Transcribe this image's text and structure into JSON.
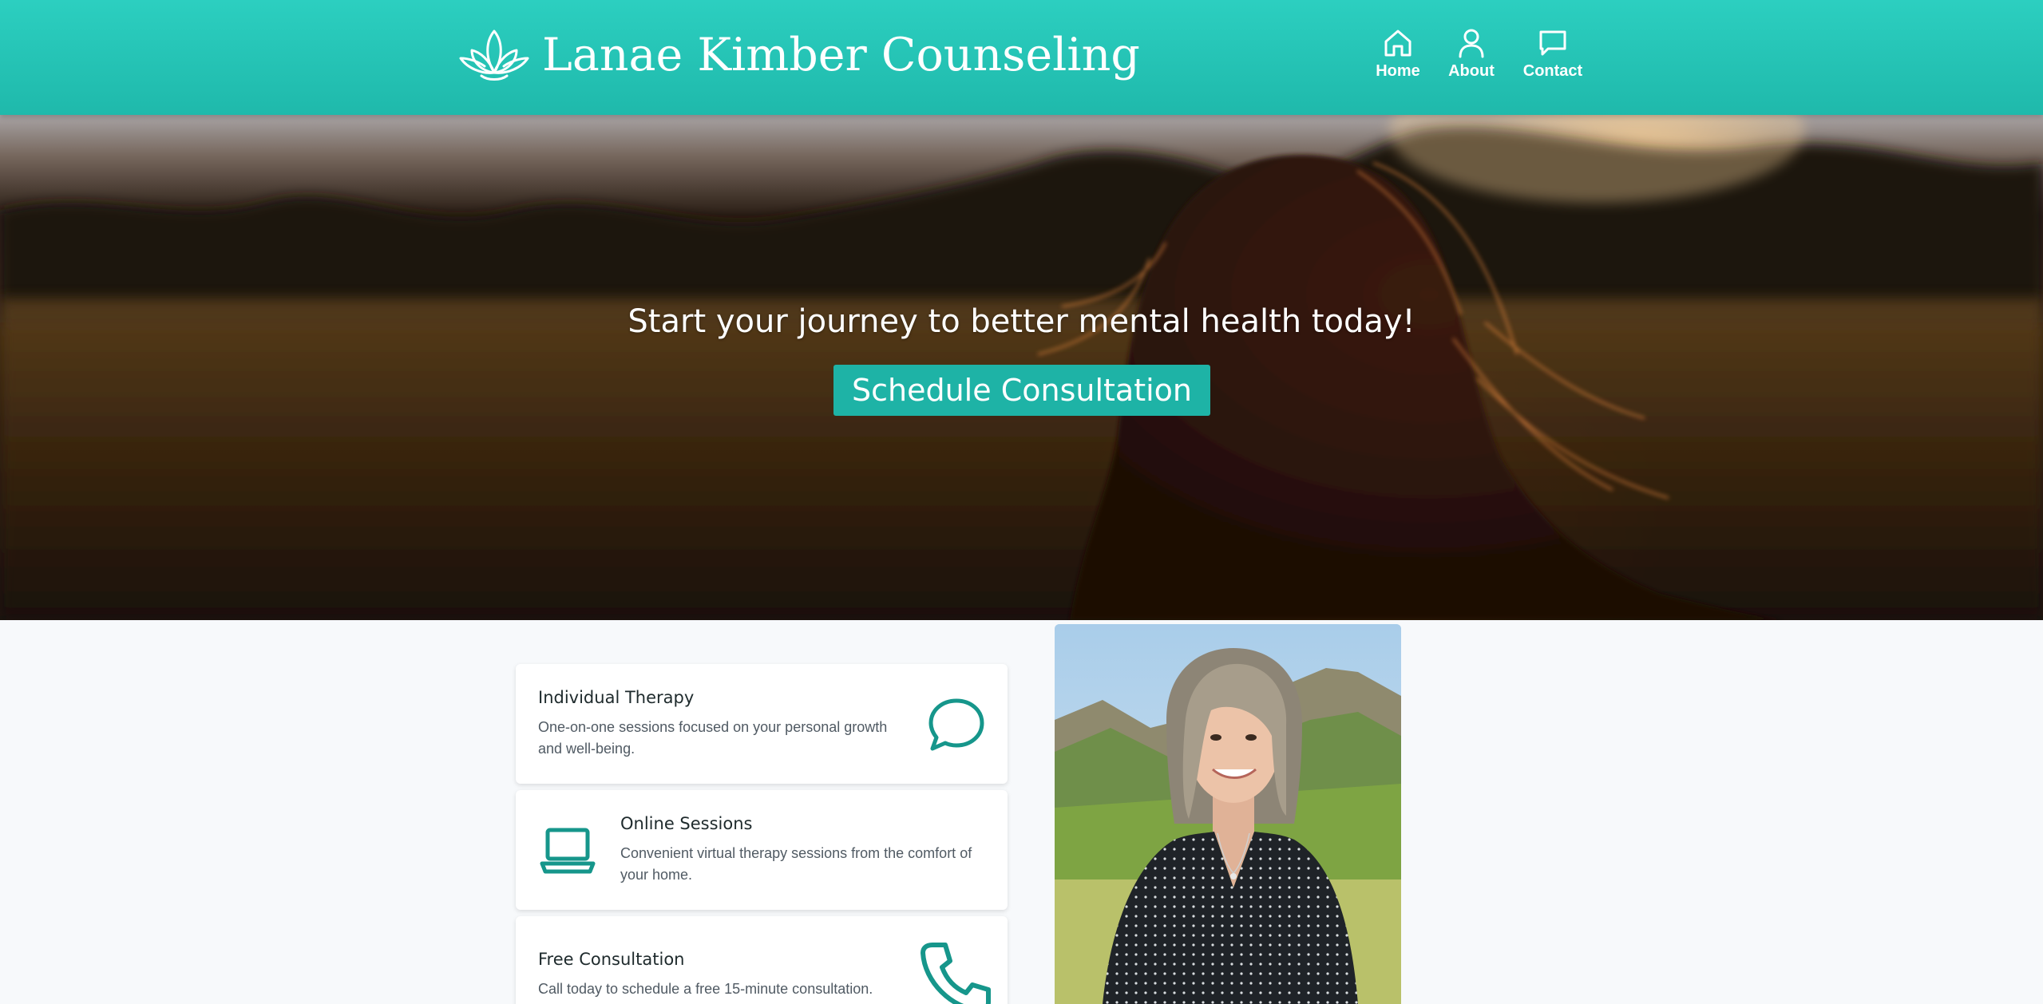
{
  "header": {
    "brand_name": "Lanae Kimber Counseling",
    "logo_icon": "lotus-icon",
    "nav": [
      {
        "label": "Home",
        "icon": "home-icon"
      },
      {
        "label": "About",
        "icon": "user-icon"
      },
      {
        "label": "Contact",
        "icon": "chat-icon"
      }
    ]
  },
  "hero": {
    "headline": "Start your journey to better mental health today!",
    "cta_label": "Schedule Consultation"
  },
  "services": [
    {
      "title": "Individual Therapy",
      "description": "One-on-one sessions focused on your personal growth and well-being.",
      "icon": "speech-bubble-icon"
    },
    {
      "title": "Online Sessions",
      "description": "Convenient virtual therapy sessions from the comfort of your home.",
      "icon": "laptop-icon"
    },
    {
      "title": "Free Consultation",
      "description": "Call today to schedule a free 15-minute consultation.",
      "icon": "phone-icon"
    }
  ],
  "colors": {
    "brand_teal": "#1eb3a6",
    "header_gradient_top": "#2ccfc0",
    "icon_teal": "#16968b",
    "page_bg": "#f7f9fb",
    "text_dark": "#1e2a2c",
    "text_muted": "#505a63"
  }
}
